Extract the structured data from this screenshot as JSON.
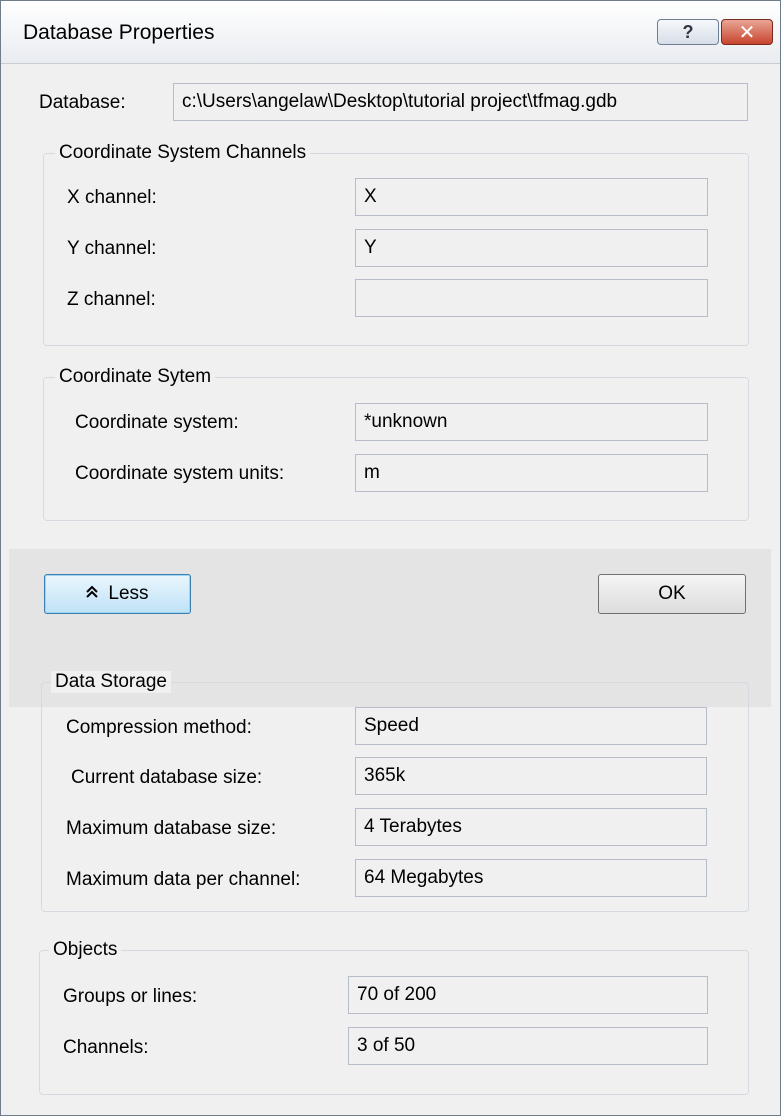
{
  "window": {
    "title": "Database Properties",
    "help_glyph": "?",
    "close_glyph": "✕"
  },
  "database": {
    "label": "Database:",
    "path": "c:\\Users\\angelaw\\Desktop\\tutorial project\\tfmag.gdb"
  },
  "coord_channels": {
    "title": "Coordinate System Channels",
    "x_label": "X channel:",
    "x_value": "X",
    "y_label": "Y channel:",
    "y_value": "Y",
    "z_label": "Z channel:",
    "z_value": ""
  },
  "coord_system": {
    "title": "Coordinate Sytem",
    "system_label": "Coordinate system:",
    "system_value": "*unknown",
    "units_label": "Coordinate system units:",
    "units_value": "m"
  },
  "buttons": {
    "less_icon": "chevron-double-up-icon",
    "less_glyph": "⌃",
    "less_label": "Less",
    "ok_label": "OK"
  },
  "data_storage": {
    "title": "Data Storage",
    "compression_label": "Compression method:",
    "compression_value": "Speed",
    "current_size_label": "Current database size:",
    "current_size_value": "365k",
    "max_size_label": "Maximum database size:",
    "max_size_value": "4 Terabytes",
    "max_per_channel_label": "Maximum data per channel:",
    "max_per_channel_value": "64 Megabytes"
  },
  "objects": {
    "title": "Objects",
    "groups_label": "Groups or lines:",
    "groups_value": "70 of 200",
    "channels_label": "Channels:",
    "channels_value": "3 of 50"
  },
  "colors": {
    "title_bar_top": "#ffffff",
    "title_bar_bottom": "#e9ecf0",
    "close_button": "#c7452d",
    "focus_button": "#bfe2f6",
    "band": "#e4e4e4"
  }
}
